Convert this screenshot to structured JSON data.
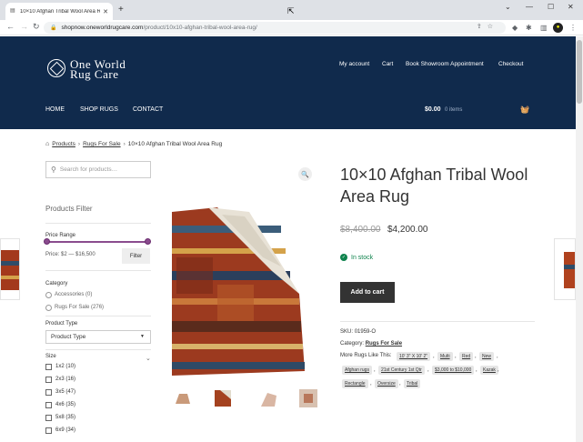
{
  "browser": {
    "tab_title": "10×10 Afghan Tribal Wool Area R",
    "url_host": "shopnow.oneworldrugcare.com",
    "url_path": "/product/10x10-afghan-tribal-wool-area-rug/"
  },
  "header": {
    "logo_line1": "One World",
    "logo_line2": "Rug Care",
    "top_links": [
      "My account",
      "Cart",
      "Book Showroom Appointment",
      "Checkout"
    ],
    "nav": [
      "HOME",
      "SHOP RUGS",
      "CONTACT"
    ],
    "cart_total": "$0.00",
    "cart_items": "0 items"
  },
  "breadcrumb": {
    "items": [
      "Products",
      "Rugs For Sale"
    ],
    "current": "10×10 Afghan Tribal Wool Area Rug"
  },
  "sidebar": {
    "search_placeholder": "Search for products…",
    "filter_title": "Products Filter",
    "price_range_label": "Price Range",
    "price_text": "Price: $2 — $16,500",
    "filter_button": "Filter",
    "category_label": "Category",
    "categories": [
      "Accessories (0)",
      "Rugs For Sale (276)"
    ],
    "product_type_label": "Product Type",
    "product_type_value": "Product Type",
    "size_label": "Size",
    "sizes": [
      "1x2 (10)",
      "2x3 (16)",
      "3x5 (47)",
      "4x6 (35)",
      "5x8 (35)",
      "6x9 (34)"
    ]
  },
  "product": {
    "title": "10×10 Afghan Tribal Wool Area Rug",
    "old_price": "$8,400.00",
    "new_price": "$4,200.00",
    "stock": "In stock",
    "add_to_cart": "Add to cart",
    "sku_label": "SKU:",
    "sku": "01959-O",
    "category_label": "Category:",
    "category": "Rugs For Sale",
    "more_label": "More Rugs Like This:",
    "tags": [
      "10' 3\" X 10' 2\"",
      "Multi",
      "Red",
      "New",
      "Afghan rugs",
      "21st Century 1st Qtr",
      "$3,000 to $10,000",
      "Kazak",
      "Rectangle",
      "Oversize",
      "Tribal"
    ]
  }
}
